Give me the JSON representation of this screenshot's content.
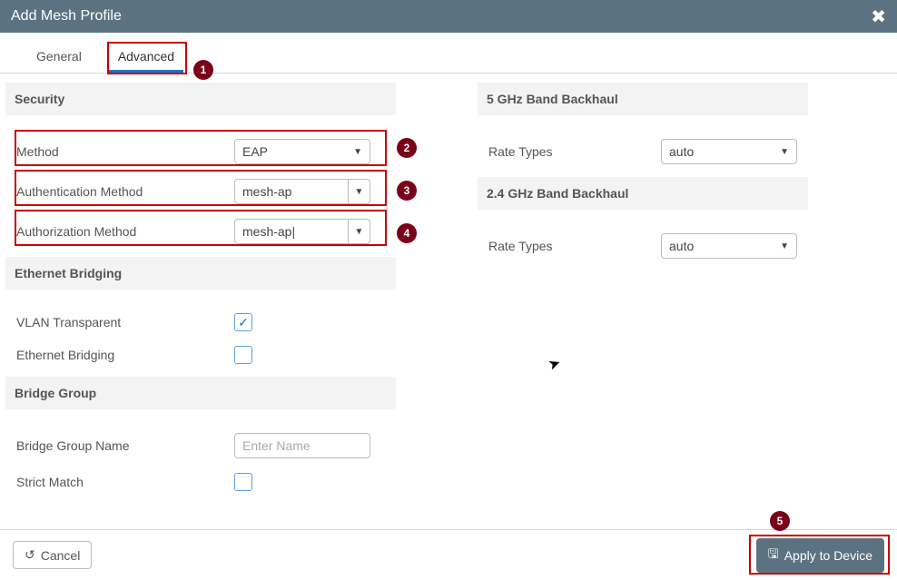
{
  "window": {
    "title": "Add Mesh Profile"
  },
  "tabs": {
    "general": "General",
    "advanced": "Advanced",
    "active": "advanced"
  },
  "annotations": {
    "a1": "1",
    "a2": "2",
    "a3": "3",
    "a4": "4",
    "a5": "5"
  },
  "security": {
    "header": "Security",
    "method_label": "Method",
    "method_value": "EAP",
    "authn_label": "Authentication Method",
    "authn_value": "mesh-ap",
    "authz_label": "Authorization Method",
    "authz_value": "mesh-ap|"
  },
  "ether": {
    "header": "Ethernet Bridging",
    "vlan_label": "VLAN Transparent",
    "vlan_checked": true,
    "eb_label": "Ethernet Bridging",
    "eb_checked": false
  },
  "bridge": {
    "header": "Bridge Group",
    "name_label": "Bridge Group Name",
    "name_placeholder": "Enter Name",
    "name_value": "",
    "strict_label": "Strict Match",
    "strict_checked": false
  },
  "backhaul5": {
    "header": "5 GHz Band Backhaul",
    "rate_label": "Rate Types",
    "rate_value": "auto"
  },
  "backhaul24": {
    "header": "2.4 GHz Band Backhaul",
    "rate_label": "Rate Types",
    "rate_value": "auto"
  },
  "footer": {
    "cancel": "Cancel",
    "apply": "Apply to Device"
  },
  "icons": {
    "check": "✓",
    "caret": "▼",
    "undo": "↺",
    "save": "🖫",
    "close": "✖"
  }
}
